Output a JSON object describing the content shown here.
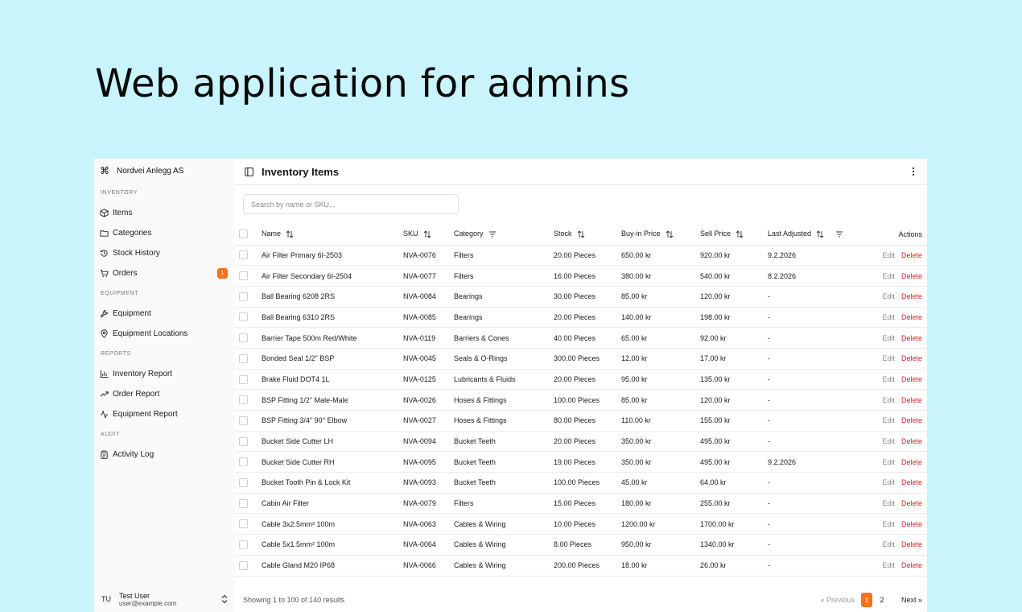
{
  "hero_title": "Web application for admins",
  "sidebar": {
    "company": "Nordvei Anlegg AS",
    "groups": [
      {
        "label": "INVENTORY",
        "items": [
          {
            "label": "Items",
            "icon": "box-icon"
          },
          {
            "label": "Categories",
            "icon": "folder-icon"
          },
          {
            "label": "Stock History",
            "icon": "history-icon"
          },
          {
            "label": "Orders",
            "icon": "cart-icon",
            "badge": "1"
          }
        ]
      },
      {
        "label": "EQUIPMENT",
        "items": [
          {
            "label": "Equipment",
            "icon": "wrench-icon"
          },
          {
            "label": "Equipment Locations",
            "icon": "map-pin-icon"
          }
        ]
      },
      {
        "label": "REPORTS",
        "items": [
          {
            "label": "Inventory Report",
            "icon": "bar-chart-icon"
          },
          {
            "label": "Order Report",
            "icon": "trending-up-icon"
          },
          {
            "label": "Equipment Report",
            "icon": "activity-icon"
          }
        ]
      },
      {
        "label": "AUDIT",
        "items": [
          {
            "label": "Activity Log",
            "icon": "clipboard-icon"
          }
        ]
      }
    ],
    "user": {
      "initials": "TU",
      "name": "Test User",
      "email": "user@example.com"
    }
  },
  "header": {
    "title": "Inventory Items"
  },
  "search": {
    "placeholder": "Search by name or SKU..."
  },
  "table": {
    "columns": {
      "name": "Name",
      "sku": "SKU",
      "category": "Category",
      "stock": "Stock",
      "buy_in": "Buy-in Price",
      "sell": "Sell Price",
      "last_adjusted": "Last Adjusted",
      "actions": "Actions"
    },
    "edit_label": "Edit",
    "delete_label": "Delete",
    "rows": [
      {
        "name": "Air Filter Primary 6I-2503",
        "sku": "NVA-0076",
        "category": "Filters",
        "stock": "20.00 Pieces",
        "buy_in": "650.00 kr",
        "sell": "920.00 kr",
        "last_adjusted": "9.2.2026"
      },
      {
        "name": "Air Filter Secondary 6I-2504",
        "sku": "NVA-0077",
        "category": "Filters",
        "stock": "16.00 Pieces",
        "buy_in": "380.00 kr",
        "sell": "540.00 kr",
        "last_adjusted": "8.2.2026"
      },
      {
        "name": "Ball Bearing 6208 2RS",
        "sku": "NVA-0084",
        "category": "Bearings",
        "stock": "30.00 Pieces",
        "buy_in": "85.00 kr",
        "sell": "120.00 kr",
        "last_adjusted": "-"
      },
      {
        "name": "Ball Bearing 6310 2RS",
        "sku": "NVA-0085",
        "category": "Bearings",
        "stock": "20.00 Pieces",
        "buy_in": "140.00 kr",
        "sell": "198.00 kr",
        "last_adjusted": "-"
      },
      {
        "name": "Barrier Tape 500m Red/White",
        "sku": "NVA-0119",
        "category": "Barriers & Cones",
        "stock": "40.00 Pieces",
        "buy_in": "65.00 kr",
        "sell": "92.00 kr",
        "last_adjusted": "-"
      },
      {
        "name": "Bonded Seal 1/2\" BSP",
        "sku": "NVA-0045",
        "category": "Seals & O-Rings",
        "stock": "300.00 Pieces",
        "buy_in": "12.00 kr",
        "sell": "17.00 kr",
        "last_adjusted": "-"
      },
      {
        "name": "Brake Fluid DOT4 1L",
        "sku": "NVA-0125",
        "category": "Lubricants & Fluids",
        "stock": "20.00 Pieces",
        "buy_in": "95.00 kr",
        "sell": "135.00 kr",
        "last_adjusted": "-"
      },
      {
        "name": "BSP Fitting 1/2\" Male-Male",
        "sku": "NVA-0026",
        "category": "Hoses & Fittings",
        "stock": "100.00 Pieces",
        "buy_in": "85.00 kr",
        "sell": "120.00 kr",
        "last_adjusted": "-"
      },
      {
        "name": "BSP Fitting 3/4\" 90° Elbow",
        "sku": "NVA-0027",
        "category": "Hoses & Fittings",
        "stock": "80.00 Pieces",
        "buy_in": "110.00 kr",
        "sell": "155.00 kr",
        "last_adjusted": "-"
      },
      {
        "name": "Bucket Side Cutter LH",
        "sku": "NVA-0094",
        "category": "Bucket Teeth",
        "stock": "20.00 Pieces",
        "buy_in": "350.00 kr",
        "sell": "495.00 kr",
        "last_adjusted": "-"
      },
      {
        "name": "Bucket Side Cutter RH",
        "sku": "NVA-0095",
        "category": "Bucket Teeth",
        "stock": "19.00 Pieces",
        "buy_in": "350.00 kr",
        "sell": "495.00 kr",
        "last_adjusted": "9.2.2026"
      },
      {
        "name": "Bucket Tooth Pin & Lock Kit",
        "sku": "NVA-0093",
        "category": "Bucket Teeth",
        "stock": "100.00 Pieces",
        "buy_in": "45.00 kr",
        "sell": "64.00 kr",
        "last_adjusted": "-"
      },
      {
        "name": "Cabin Air Filter",
        "sku": "NVA-0079",
        "category": "Filters",
        "stock": "15.00 Pieces",
        "buy_in": "180.00 kr",
        "sell": "255.00 kr",
        "last_adjusted": "-"
      },
      {
        "name": "Cable 3x2.5mm² 100m",
        "sku": "NVA-0063",
        "category": "Cables & Wiring",
        "stock": "10.00 Pieces",
        "buy_in": "1200.00 kr",
        "sell": "1700.00 kr",
        "last_adjusted": "-"
      },
      {
        "name": "Cable 5x1.5mm² 100m",
        "sku": "NVA-0064",
        "category": "Cables & Wiring",
        "stock": "8.00 Pieces",
        "buy_in": "950.00 kr",
        "sell": "1340.00 kr",
        "last_adjusted": "-"
      },
      {
        "name": "Cable Gland M20 IP68",
        "sku": "NVA-0066",
        "category": "Cables & Wiring",
        "stock": "200.00 Pieces",
        "buy_in": "18.00 kr",
        "sell": "26.00 kr",
        "last_adjusted": "-"
      }
    ]
  },
  "footer": {
    "summary": "Showing 1 to 100 of 140 results",
    "previous": "« Previous",
    "pages": [
      "1",
      "2"
    ],
    "current_page": "1",
    "next": "Next »"
  },
  "colors": {
    "accent": "#f97316",
    "danger": "#e02424",
    "background": "#c9f4fb"
  }
}
